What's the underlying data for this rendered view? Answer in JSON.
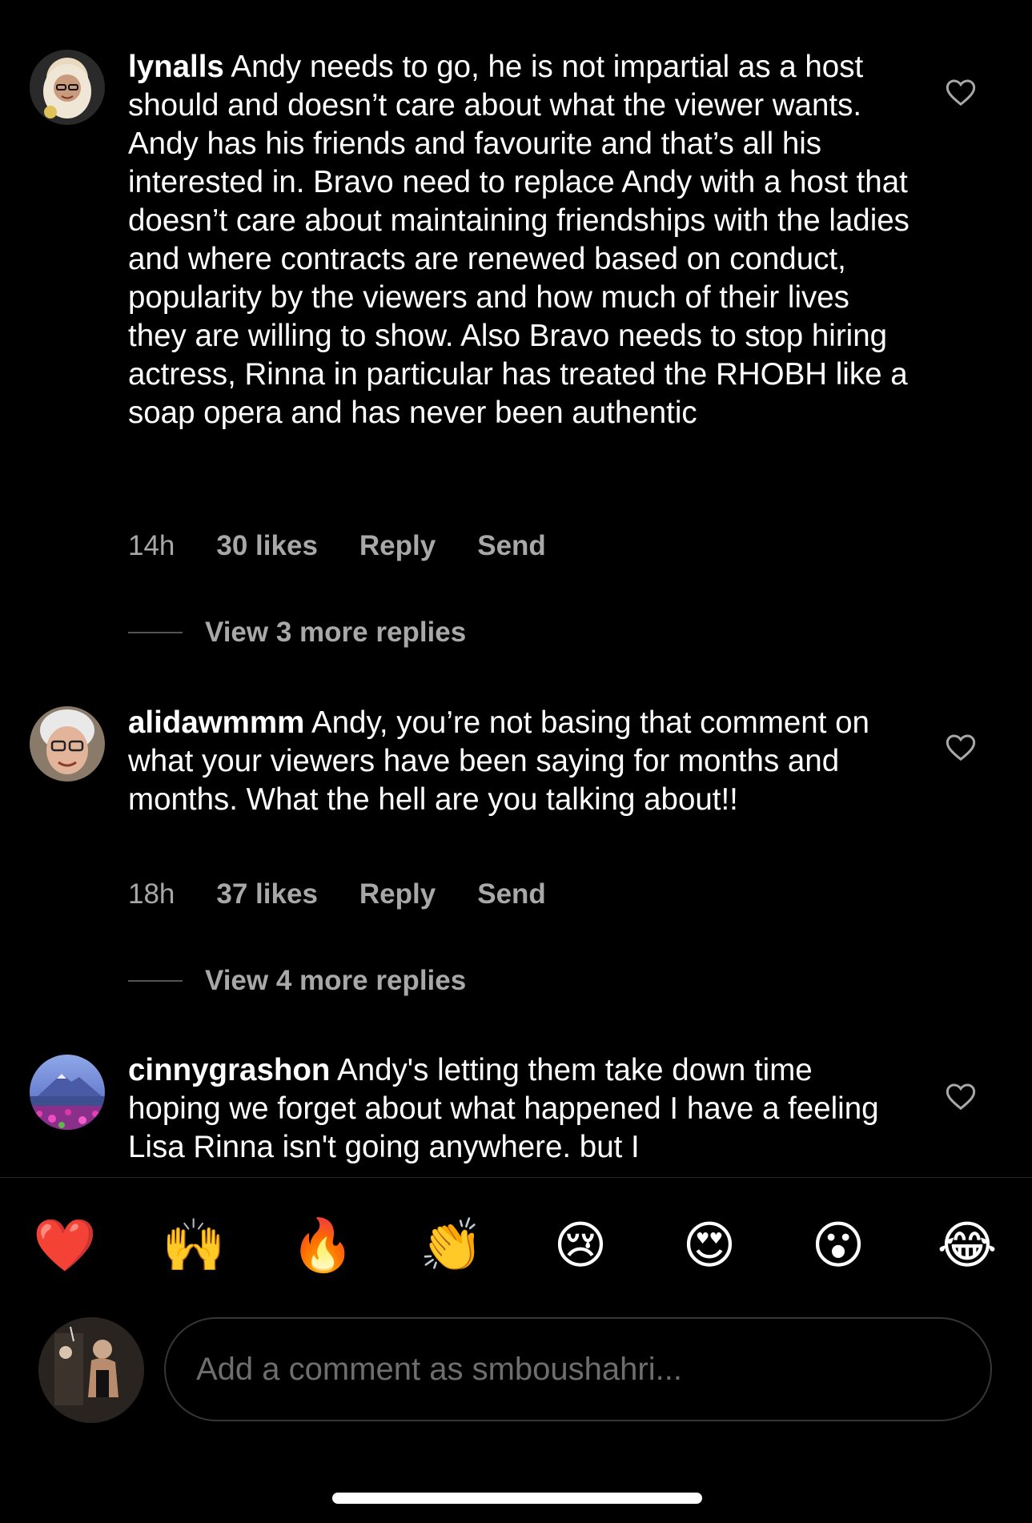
{
  "comments": [
    {
      "username": "lynalls",
      "text": "Andy needs to go, he is not impartial as a host should and doesn’t care about what the viewer wants. Andy has his friends and favourite and that’s all his interested in. Bravo need to replace Andy with a host that doesn’t care about maintaining friendships with the ladies and where contracts are renewed based on conduct, popularity by the viewers and how much of their lives they are willing to show. Also Bravo needs to stop hiring actress, Rinna in particular has treated the RHOBH like a soap opera and has never been authentic",
      "time": "14h",
      "likes": "30 likes",
      "reply": "Reply",
      "send": "Send",
      "view_replies": "View 3 more replies"
    },
    {
      "username": "alidawmmm",
      "text": "Andy, you’re not basing that comment on what your viewers have been saying for months and months. What the hell are you talking about!!",
      "time": "18h",
      "likes": "37 likes",
      "reply": "Reply",
      "send": "Send",
      "view_replies": "View 4 more replies"
    },
    {
      "username": "cinnygrashon",
      "text": "Andy's letting them take down time hoping we forget about what happened I have a feeling Lisa Rinna isn't going anywhere. but I"
    }
  ],
  "emoji_bar": [
    "❤️",
    "🙌",
    "🔥",
    "👏",
    "😢",
    "😍",
    "😮",
    "😂"
  ],
  "composer": {
    "placeholder": "Add a comment as smboushahri..."
  }
}
